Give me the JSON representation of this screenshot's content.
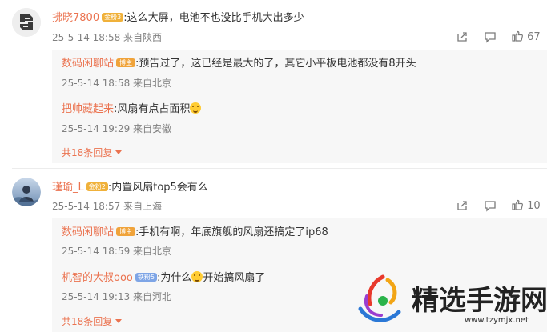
{
  "comments": [
    {
      "author": "拂晓7800",
      "badge": "金粉3",
      "text": ":这么大屏，电池不也没比手机大出多少",
      "meta": "25-5-14 18:58 来自陕西",
      "like_count": "67",
      "replies": [
        {
          "author": "数码闲聊站",
          "badge": "博主",
          "text": ":预告过了，这已经是最大的了，其它小平板电池都没有8开头",
          "meta": "25-5-14 18:58 来自北京"
        },
        {
          "author": "把帅藏起来",
          "text": ":风扇有点占面积",
          "meta": "25-5-14 19:29 来自安徽"
        }
      ],
      "more": "共18条回复"
    },
    {
      "author": "瑾瑜_L",
      "badge": "金粉2",
      "text": ":内置风扇top5会有么",
      "meta": "25-5-14 18:57 来自上海",
      "like_count": "10",
      "replies": [
        {
          "author": "数码闲聊站",
          "badge": "博主",
          "text": ":手机有啊，年底旗舰的风扇还搞定了ip68",
          "meta": "25-5-14 18:59 来自北京"
        },
        {
          "author": "机智的大叔ooo",
          "badge": "铁粉5",
          "text_a": ":为什么",
          "text_b": "开始搞风扇了",
          "meta": "25-5-14 19:13 来自河北"
        }
      ],
      "more": "共18条回复"
    }
  ],
  "watermark": {
    "title": "精选手游网",
    "url": "www.tzymjx.net"
  },
  "colors": {
    "name": "#eb7350",
    "meta": "#808080",
    "reply_bg": "#f7f7f7"
  },
  "icons": [
    "share-icon",
    "comment-icon",
    "like-icon",
    "caret-down-icon",
    "emoji-icon"
  ]
}
